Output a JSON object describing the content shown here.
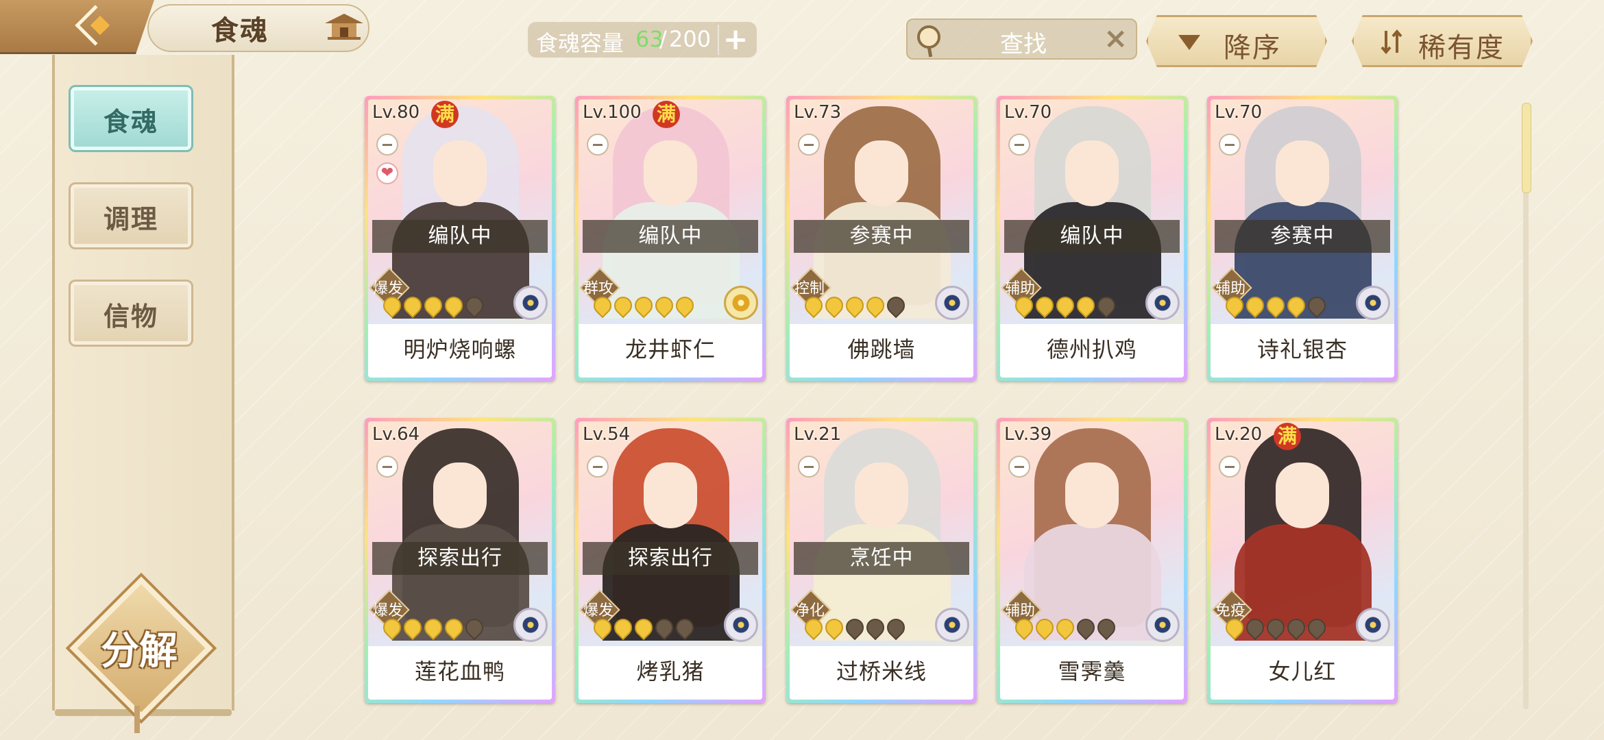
{
  "header": {
    "title": "食魂",
    "capacity": {
      "label": "食魂容量",
      "current": "63",
      "sep": "/",
      "max": "200",
      "add": "+"
    },
    "search": {
      "placeholder": "查找",
      "clear": "×"
    },
    "sort_label": "降序",
    "rarity_label": "稀有度"
  },
  "sidebar": {
    "items": [
      {
        "label": "食魂"
      },
      {
        "label": "调理"
      },
      {
        "label": "信物"
      }
    ],
    "decompose_label": "分解"
  },
  "full_badge": "满",
  "cards": [
    {
      "level": "Lv.80",
      "full": true,
      "heart": true,
      "status": "编队中",
      "role": "爆发",
      "name": "明炉烧响螺",
      "stars": 5,
      "filled": 4,
      "emblem": "blue",
      "hair": "#e6e2ee",
      "body": "#4b3d3a"
    },
    {
      "level": "Lv.100",
      "full": true,
      "heart": false,
      "status": "编队中",
      "role": "群攻",
      "name": "龙井虾仁",
      "stars": 5,
      "filled": 5,
      "emblem": "gold",
      "hair": "#f2c5d3",
      "body": "#e7efe9"
    },
    {
      "level": "Lv.73",
      "full": false,
      "heart": false,
      "status": "参赛中",
      "role": "控制",
      "name": "佛跳墙",
      "stars": 5,
      "filled": 4,
      "emblem": "blue",
      "hair": "#9a6a42",
      "body": "#f3ead7"
    },
    {
      "level": "Lv.70",
      "full": false,
      "heart": false,
      "status": "编队中",
      "role": "辅助",
      "name": "德州扒鸡",
      "stars": 5,
      "filled": 4,
      "emblem": "blue",
      "hair": "#d6d8d4",
      "body": "#2c2a2d"
    },
    {
      "level": "Lv.70",
      "full": false,
      "heart": false,
      "status": "参赛中",
      "role": "辅助",
      "name": "诗礼银杏",
      "stars": 5,
      "filled": 4,
      "emblem": "blue",
      "hair": "#cfcdd2",
      "body": "#3c4a6a"
    },
    {
      "level": "Lv.64",
      "full": false,
      "heart": false,
      "status": "探索出行",
      "role": "爆发",
      "name": "莲花血鸭",
      "stars": 5,
      "filled": 4,
      "emblem": "blue",
      "hair": "#332a25",
      "body": "#5b4f48"
    },
    {
      "level": "Lv.54",
      "full": false,
      "heart": false,
      "status": "探索出行",
      "role": "爆发",
      "name": "烤乳猪",
      "stars": 5,
      "filled": 3,
      "emblem": "blue",
      "hair": "#c94a2a",
      "body": "#2b2624"
    },
    {
      "level": "Lv.21",
      "full": false,
      "heart": false,
      "status": "烹饪中",
      "role": "净化",
      "name": "过桥米线",
      "stars": 5,
      "filled": 2,
      "emblem": "blue",
      "hair": "#dadcd8",
      "body": "#f4ecd3"
    },
    {
      "level": "Lv.39",
      "full": false,
      "heart": false,
      "status": "",
      "role": "辅助",
      "name": "雪霁羹",
      "stars": 5,
      "filled": 3,
      "emblem": "blue",
      "hair": "#a56a4a",
      "body": "#ead6e0"
    },
    {
      "level": "Lv.20",
      "full": true,
      "heart": false,
      "status": "",
      "role": "免疫",
      "name": "女儿红",
      "stars": 5,
      "filled": 1,
      "emblem": "blue",
      "hair": "#2e2322",
      "body": "#a43428"
    }
  ]
}
